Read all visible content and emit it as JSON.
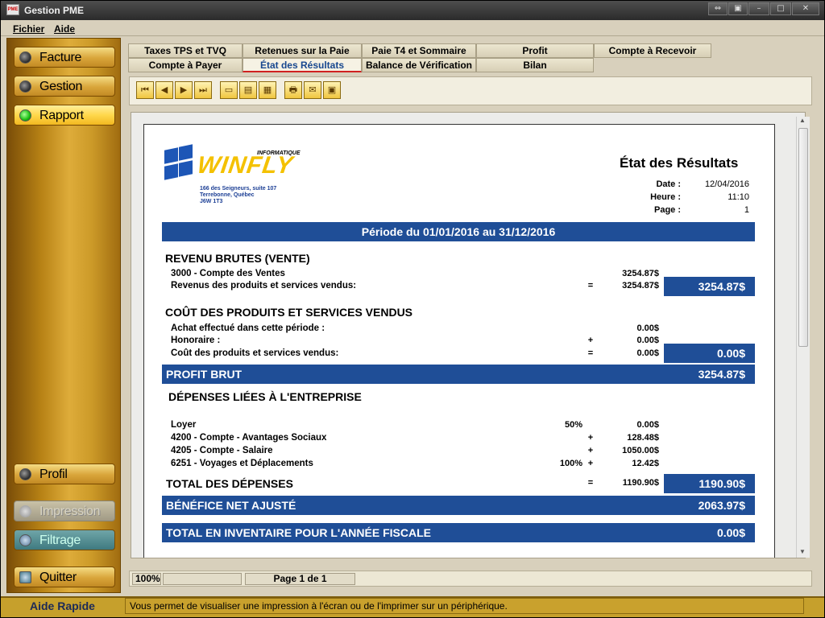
{
  "window": {
    "title": "Gestion PME",
    "icon_label": "PME"
  },
  "menubar": {
    "items": [
      {
        "label": "Fichier"
      },
      {
        "label": "Aide"
      }
    ]
  },
  "sidebar": {
    "items": [
      {
        "label": "Facture",
        "state": "normal"
      },
      {
        "label": "Gestion",
        "state": "normal"
      },
      {
        "label": "Rapport",
        "state": "active"
      },
      {
        "label": "Profil",
        "state": "normal"
      },
      {
        "label": "Impression",
        "state": "disabled"
      },
      {
        "label": "Filtrage",
        "state": "teal"
      },
      {
        "label": "Quitter",
        "state": "normal"
      }
    ]
  },
  "tabs": {
    "row1": [
      "Taxes TPS et TVQ",
      "Retenues sur la Paie",
      "Paie T4 et Sommaire",
      "Profit",
      "Compte à Recevoir"
    ],
    "row2": [
      "Compte à Payer",
      "État des Résultats",
      "Balance de Vérification",
      "Bilan"
    ],
    "selected": "État des Résultats"
  },
  "toolbar": {
    "icons": [
      "first-page-icon",
      "prev-page-icon",
      "next-page-icon",
      "last-page-icon",
      "one-page-icon",
      "page-width-icon",
      "multi-page-icon",
      "print-icon",
      "email-icon",
      "save-icon"
    ],
    "glyphs": {
      "first": "⏮",
      "prev": "◀",
      "next": "▶",
      "last": "⏭",
      "one": "▭",
      "width": "▤",
      "multi": "▦",
      "print": "🖶",
      "email": "✉",
      "save": "▣"
    }
  },
  "report": {
    "logo": {
      "brand": "WINFLY",
      "sub": "INFORMATIQUE",
      "address1": "166 des Seigneurs, suite 107",
      "address2": "Terrebonne, Québec",
      "address3": "J6W 1T3"
    },
    "title": "État des Résultats",
    "meta": {
      "date_label": "Date :",
      "date": "12/04/2016",
      "time_label": "Heure :",
      "time": "11:10",
      "page_label": "Page :",
      "page": "1"
    },
    "period": "Période du 01/01/2016 au 31/12/2016",
    "revenue": {
      "heading": "REVENU BRUTES (VENTE)",
      "line1_label": "3000 - Compte des Ventes",
      "line1_amt": "3254.87$",
      "line2_label": "Revenus des produits et services vendus:",
      "line2_op": "=",
      "line2_amt": "3254.87$",
      "total": "3254.87$"
    },
    "cogs": {
      "heading": "COÛT DES PRODUITS ET SERVICES VENDUS",
      "line1_label": "Achat effectué dans cette période :",
      "line1_amt": "0.00$",
      "line2_label": "Honoraire :",
      "line2_op": "+",
      "line2_amt": "0.00$",
      "line3_label": "Coût des produits et services vendus:",
      "line3_op": "=",
      "line3_amt": "0.00$",
      "total": "0.00$"
    },
    "gross": {
      "label": "PROFIT BRUT",
      "amount": "3254.87$"
    },
    "expenses": {
      "heading": "DÉPENSES LIÉES À L'ENTREPRISE",
      "rows": [
        {
          "label": "Loyer",
          "pct": "50%",
          "op": "",
          "amt": "0.00$"
        },
        {
          "label": "4200 - Compte - Avantages Sociaux",
          "pct": "",
          "op": "+",
          "amt": "128.48$"
        },
        {
          "label": "4205 - Compte - Salaire",
          "pct": "",
          "op": "+",
          "amt": "1050.00$"
        },
        {
          "label": "6251 - Voyages et Déplacements",
          "pct": "100%",
          "op": "+",
          "amt": "12.42$"
        }
      ],
      "total_label": "TOTAL DES DÉPENSES",
      "total_op": "=",
      "total_amt": "1190.90$",
      "total_box": "1190.90$"
    },
    "net": {
      "label": "BÉNÉFICE NET AJUSTÉ",
      "amount": "2063.97$"
    },
    "inventory": {
      "label": "TOTAL EN INVENTAIRE POUR L'ANNÉE FISCALE",
      "amount": "0.00$"
    }
  },
  "statusbar": {
    "zoom": "100%",
    "page": "Page 1 de 1"
  },
  "aide": {
    "label": "Aide Rapide",
    "message": "Vous permet de visualiser une impression à l'écran ou de l'imprimer sur un périphérique."
  },
  "colors": {
    "band": "#1f4e97",
    "sidebar": "#deac3a",
    "active_led": "#1bbf12"
  }
}
